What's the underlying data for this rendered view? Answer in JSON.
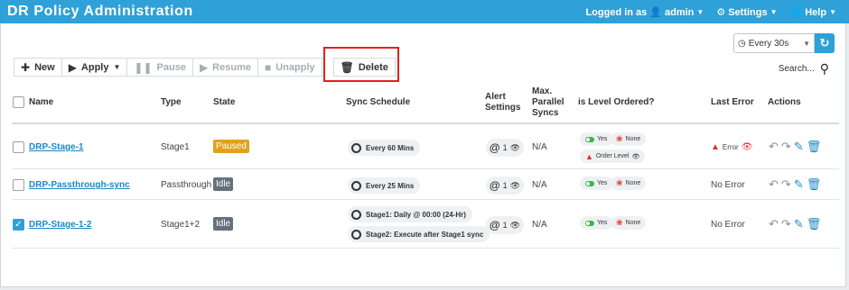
{
  "header": {
    "title": "DR Policy Administration",
    "logged_in_label": "Logged in as",
    "user": "admin",
    "settings": "Settings",
    "help": "Help"
  },
  "refresh": {
    "interval": "Every 30s"
  },
  "toolbar": {
    "new": "New",
    "apply": "Apply",
    "pause": "Pause",
    "resume": "Resume",
    "unapply": "Unapply",
    "delete": "Delete"
  },
  "search": {
    "label": "Search..."
  },
  "columns": {
    "name": "Name",
    "type": "Type",
    "state": "State",
    "sync_schedule": "Sync Schedule",
    "alert_settings": [
      "Alert",
      "Settings"
    ],
    "max_parallel": [
      "Max.",
      "Parallel",
      "Syncs"
    ],
    "level_ordered": "is Level Ordered?",
    "last_error": "Last Error",
    "actions": "Actions"
  },
  "rows": [
    {
      "checked": false,
      "name": "DRP-Stage-1",
      "type": "Stage1",
      "state": "Paused",
      "schedule": [
        "Every 60 Mins"
      ],
      "alert_count": "1",
      "max_parallel": "N/A",
      "level": {
        "yes": "Yes",
        "none": "None",
        "order": "Order Level"
      },
      "last_error": "Error"
    },
    {
      "checked": false,
      "name": "DRP-Passthrough-sync",
      "type": "Passthrough",
      "state": "Idle",
      "schedule": [
        "Every 25 Mins"
      ],
      "alert_count": "1",
      "max_parallel": "N/A",
      "level": {
        "yes": "Yes",
        "none": "None"
      },
      "last_error": "No Error"
    },
    {
      "checked": true,
      "name": "DRP-Stage-1-2",
      "type": "Stage1+2",
      "state": "Idle",
      "schedule": [
        "Stage1: Daily @ 00:00 (24-Hr)",
        "Stage2: Execute after Stage1 sync"
      ],
      "alert_count": "1",
      "max_parallel": "N/A",
      "level": {
        "yes": "Yes",
        "none": "None"
      },
      "last_error": "No Error"
    }
  ],
  "colors": {
    "accent": "#2ea1d8",
    "paused": "#e0a21b",
    "idle": "#66707a",
    "danger": "#e0302f",
    "link": "#1c89c6"
  },
  "icons": [
    "user-icon",
    "gear-icon",
    "globe-icon",
    "refresh-icon",
    "plus-icon",
    "play-icon",
    "pause-icon",
    "resume-icon",
    "stop-icon",
    "trash-icon",
    "search-icon",
    "clock-icon",
    "eye-icon",
    "toggle-icon",
    "runner-icon",
    "warning-icon",
    "undo-icon",
    "redo-icon",
    "edit-icon"
  ]
}
